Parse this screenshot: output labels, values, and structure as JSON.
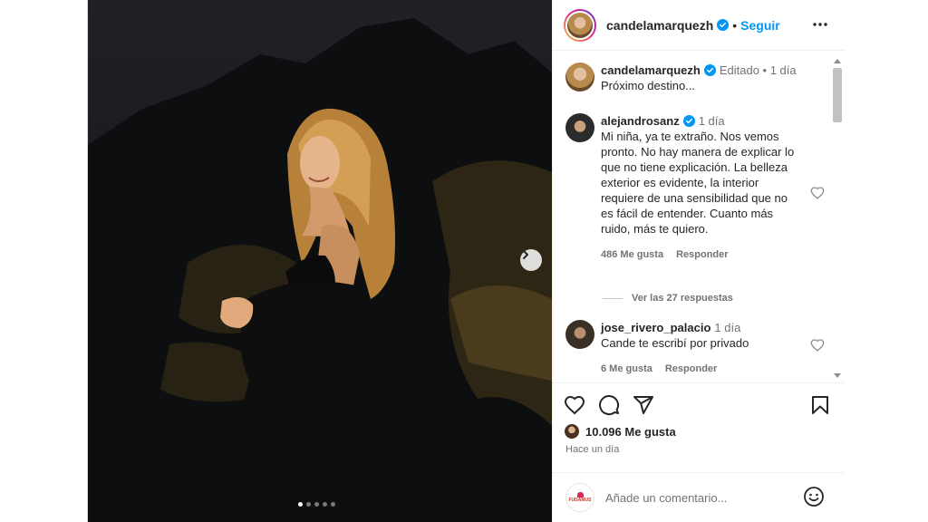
{
  "post": {
    "author": "candelamarquezh",
    "follow_label": "Seguir",
    "separator": "•",
    "carousel_dots": 5,
    "active_dot": 0
  },
  "comments": [
    {
      "user": "candelamarquezh",
      "meta": "Editado • 1 día",
      "text": "Próximo destino...",
      "verified": true
    },
    {
      "user": "alejandrosanz",
      "meta": "1 día",
      "text": "Mi niña, ya te extraño. Nos vemos pronto. No hay manera de explicar lo que no tiene explicación. La belleza exterior es evidente, la interior requiere de una sensibilidad que no es fácil de entender. Cuanto más ruido, más te quiero.",
      "likes": "486 Me gusta",
      "reply_label": "Responder",
      "replies_label": "Ver las 27 respuestas",
      "verified": true
    },
    {
      "user": "jose_rivero_palacio",
      "meta": "1 día",
      "text": "Cande te escribí por privado",
      "likes": "6 Me gusta",
      "reply_label": "Responder"
    }
  ],
  "stats": {
    "likes": "10.096 Me gusta",
    "time": "Hace un día"
  },
  "comment_box": {
    "placeholder": "Añade un comentario...",
    "avatar_text": "FUDAMUS"
  },
  "colors": {
    "accent": "#0095f6",
    "verified": "#0095f6",
    "muted": "#737373",
    "text": "#262626"
  },
  "icons": [
    "chevron-right-icon",
    "more-icon",
    "verified-icon",
    "heart-icon",
    "comment-icon",
    "share-icon",
    "bookmark-icon",
    "emoji-icon"
  ]
}
